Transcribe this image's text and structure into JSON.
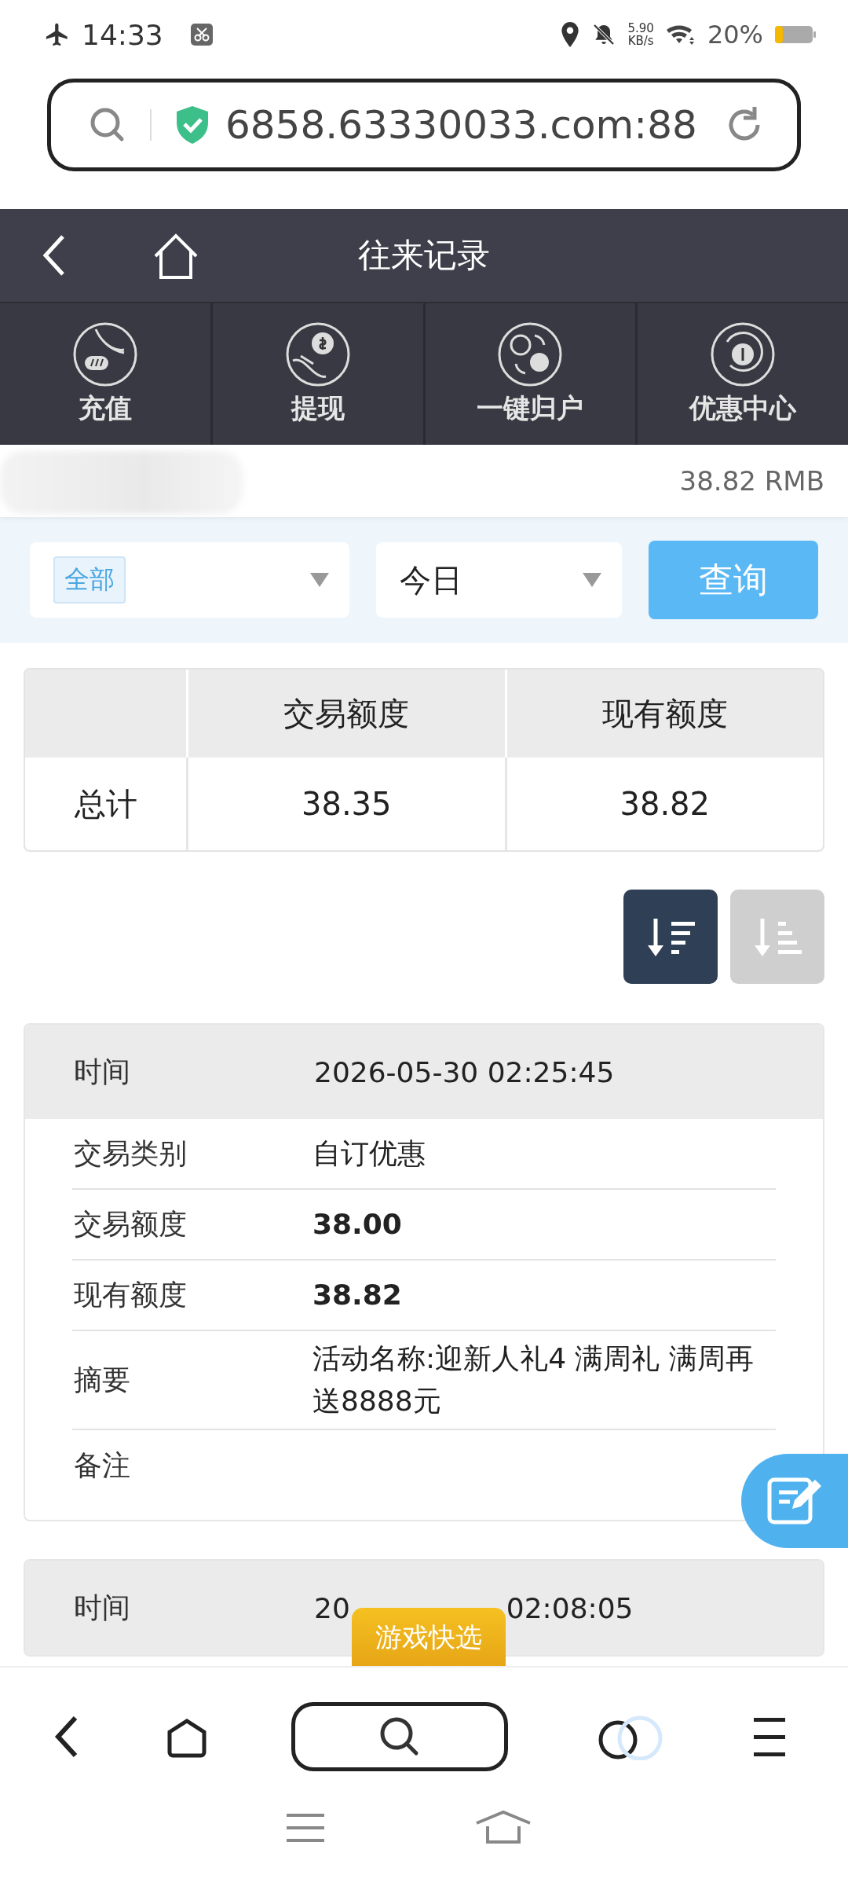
{
  "status_bar": {
    "time": "14:33",
    "net_speed": [
      "5.90",
      "KB/s"
    ],
    "battery": "20%"
  },
  "url_bar": {
    "url": "6858.63330033.com:88"
  },
  "header": {
    "title": "往来记录"
  },
  "quick_actions": [
    {
      "label": "充值",
      "kind": "deposit"
    },
    {
      "label": "提现",
      "kind": "withdraw"
    },
    {
      "label": "一键归户",
      "kind": "transfer"
    },
    {
      "label": "优惠中心",
      "kind": "promo"
    }
  ],
  "balance": "38.82 RMB",
  "filters": {
    "type_select": "全部",
    "date_select": "今日",
    "query_button": "查询"
  },
  "summary": {
    "columns": [
      "交易额度",
      "现有额度"
    ],
    "rows": [
      {
        "label": "总计",
        "values": [
          "38.35",
          "38.82"
        ]
      }
    ]
  },
  "sort_buttons": [
    {
      "kind": "desc",
      "selected": true
    },
    {
      "kind": "asc",
      "selected": false
    }
  ],
  "records": [
    {
      "time_label": "时间",
      "time": "2026-05-30 02:25:45",
      "fields": [
        {
          "label": "交易类别",
          "value": "自订优惠",
          "bold": false
        },
        {
          "label": "交易额度",
          "value": "38.00",
          "bold": true
        },
        {
          "label": "现有额度",
          "value": "38.82",
          "bold": true
        },
        {
          "label": "摘要",
          "value": "活动名称:迎新人礼4 满周礼 满周再送8888元",
          "bold": false
        },
        {
          "label": "备注"
        }
      ]
    },
    {
      "time_label": "时间",
      "time_parts": [
        "20",
        "02:08:05"
      ]
    }
  ],
  "floating_badge": "游戏快选"
}
